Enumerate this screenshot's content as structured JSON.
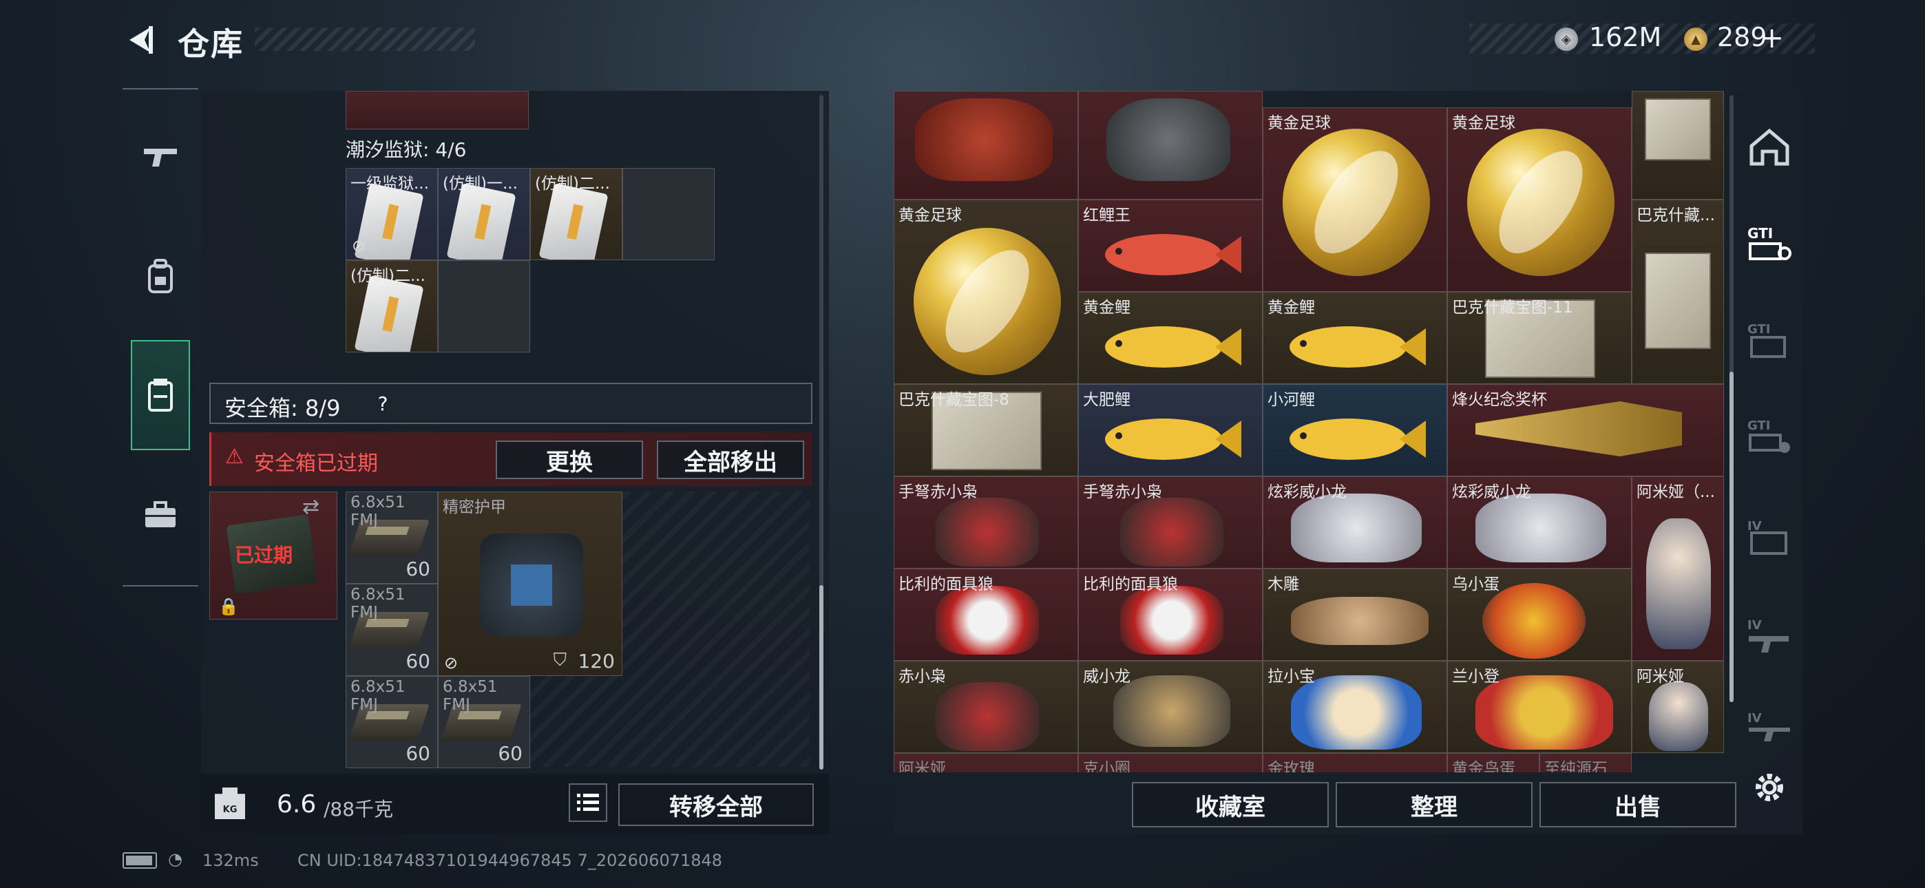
{
  "header": {
    "title": "仓库"
  },
  "currency": {
    "silver": "162M",
    "gold": "289",
    "gold_plus": "+"
  },
  "left_panel": {
    "prison_title": "潮汐监狱: 4/6",
    "prison_items": [
      {
        "label": "一级监狱..."
      },
      {
        "label": "(仿制)一..."
      },
      {
        "label": "(仿制)二..."
      },
      {
        "label": "(仿制)二..."
      }
    ],
    "safe_box_title": "安全箱: 8/9",
    "safe_box_help": "?",
    "expired_warning": "安全箱已过期",
    "replace_button": "更换",
    "move_all_out_button": "全部移出",
    "expired_badge": "已过期",
    "safe_items": [
      {
        "label": "6.8x51 FMJ",
        "count": "60"
      },
      {
        "label": "精密护甲",
        "durability": "120"
      },
      {
        "label": "6.8x51 FMJ",
        "count": "60"
      },
      {
        "label": "6.8x51 FMJ",
        "count": "60"
      },
      {
        "label": "6.8x51 FMJ",
        "count": "60"
      }
    ],
    "weight_current": "6.6",
    "weight_max": "/88千克",
    "weight_icon_text": "KG",
    "transfer_all_button": "转移全部"
  },
  "right_panel": {
    "items": [
      {
        "label": "黄金足球"
      },
      {
        "label": "黄金足球"
      },
      {
        "label": "黄金足球"
      },
      {
        "label": "红鲤王"
      },
      {
        "label": "巴克什藏..."
      },
      {
        "label": "黄金鲤"
      },
      {
        "label": "黄金鲤"
      },
      {
        "label": "巴克什藏宝图-11"
      },
      {
        "label": "巴克什藏宝图-8"
      },
      {
        "label": "大肥鲤"
      },
      {
        "label": "小河鲤"
      },
      {
        "label": "烽火纪念奖杯"
      },
      {
        "label": "手弩赤小枭"
      },
      {
        "label": "手弩赤小枭"
      },
      {
        "label": "炫彩威小龙"
      },
      {
        "label": "炫彩威小龙"
      },
      {
        "label": "阿米娅（..."
      },
      {
        "label": "比利的面具狼"
      },
      {
        "label": "比利的面具狼"
      },
      {
        "label": "木雕"
      },
      {
        "label": "乌小蛋"
      },
      {
        "label": "赤小枭"
      },
      {
        "label": "威小龙"
      },
      {
        "label": "拉小宝"
      },
      {
        "label": "兰小登"
      },
      {
        "label": "阿米娅"
      },
      {
        "label": "阿米娅"
      },
      {
        "label": "克小圈"
      },
      {
        "label": "金玫瑰"
      },
      {
        "label": "黄金鸟蛋"
      },
      {
        "label": "至纯源石"
      }
    ],
    "collection_button": "收藏室",
    "sort_button": "整理",
    "sell_button": "出售"
  },
  "status_bar": {
    "ping": "132ms",
    "uid": "CN UID:18474837101944967845 7_202606071848"
  }
}
